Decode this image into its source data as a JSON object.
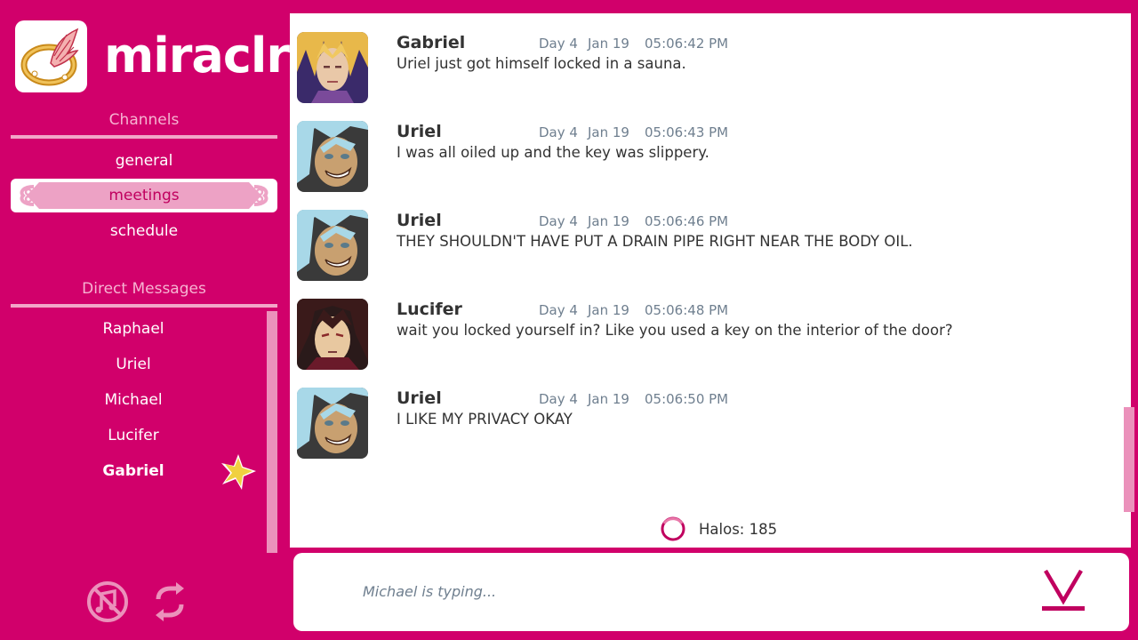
{
  "app": {
    "title": "miraclr"
  },
  "channels": {
    "heading": "Channels",
    "items": [
      {
        "label": "general",
        "active": false
      },
      {
        "label": "meetings",
        "active": true
      },
      {
        "label": "schedule",
        "active": false
      }
    ]
  },
  "direct_messages": {
    "heading": "Direct Messages",
    "items": [
      {
        "label": "Raphael"
      },
      {
        "label": "Uriel"
      },
      {
        "label": "Michael"
      },
      {
        "label": "Lucifer"
      },
      {
        "label": "Gabriel",
        "bold": true,
        "starred": true
      }
    ]
  },
  "messages": [
    {
      "author": "Gabriel",
      "day": "Day 4",
      "date": "Jan 19",
      "time": "05:06:42 PM",
      "text": "Uriel just got himself locked in a sauna.",
      "avatar": "gabriel-avatar"
    },
    {
      "author": "Uriel",
      "day": "Day 4",
      "date": "Jan 19",
      "time": "05:06:43 PM",
      "text": "I was all oiled up and the key was slippery.",
      "avatar": "uriel-avatar"
    },
    {
      "author": "Uriel",
      "day": "Day 4",
      "date": "Jan 19",
      "time": "05:06:46 PM",
      "text": "THEY SHOULDN'T HAVE PUT A DRAIN PIPE RIGHT NEAR THE BODY OIL.",
      "avatar": "uriel-avatar"
    },
    {
      "author": "Lucifer",
      "day": "Day 4",
      "date": "Jan 19",
      "time": "05:06:48 PM",
      "text": "wait you locked yourself in? Like you used a key on the interior of the door?",
      "avatar": "lucifer-avatar"
    },
    {
      "author": "Uriel",
      "day": "Day 4",
      "date": "Jan 19",
      "time": "05:06:50 PM",
      "text": "I LIKE MY PRIVACY OKAY",
      "avatar": "uriel-avatar"
    }
  ],
  "halos": {
    "label": "Halos: 185"
  },
  "input": {
    "typing_status": "Michael is typing..."
  },
  "icons": {
    "mute": "music-off-icon",
    "refresh": "refresh-icon",
    "send": "send-icon",
    "star": "star-icon",
    "halo": "halo-icon"
  },
  "colors": {
    "background": "#d1006b",
    "accent_light": "#f2a6c8",
    "active_pill": "#eda2c5",
    "text_dark": "#333333",
    "meta_gray": "#6f7f8f"
  }
}
